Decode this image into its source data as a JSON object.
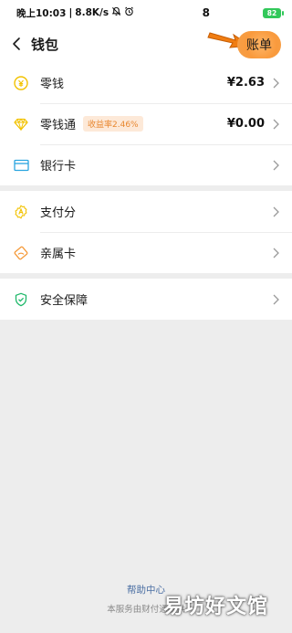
{
  "status_bar": {
    "time": "晚上10:03",
    "separator": "|",
    "speed": "8.8K/s",
    "right_num": "8",
    "battery": "82"
  },
  "header": {
    "title": "钱包",
    "bill_label": "账单"
  },
  "group1": [
    {
      "label": "零钱",
      "value": "¥2.63",
      "icon": "coin-icon",
      "icon_color": "#f2c200"
    },
    {
      "label": "零钱通",
      "badge": "收益率2.46%",
      "value": "¥0.00",
      "icon": "diamond-icon",
      "icon_color": "#f2c200"
    },
    {
      "label": "银行卡",
      "icon": "card-icon",
      "icon_color": "#2aa5e0"
    }
  ],
  "group2": [
    {
      "label": "支付分",
      "icon": "score-icon",
      "icon_color": "#f2c200"
    },
    {
      "label": "亲属卡",
      "icon": "family-card-icon",
      "icon_color": "#f59a3a"
    }
  ],
  "group3": [
    {
      "label": "安全保障",
      "icon": "shield-icon",
      "icon_color": "#1fb86a"
    }
  ],
  "footer": {
    "help_link": "帮助中心",
    "service_note": "本服务由财付通提供",
    "watermark": "易坊好文馆"
  }
}
